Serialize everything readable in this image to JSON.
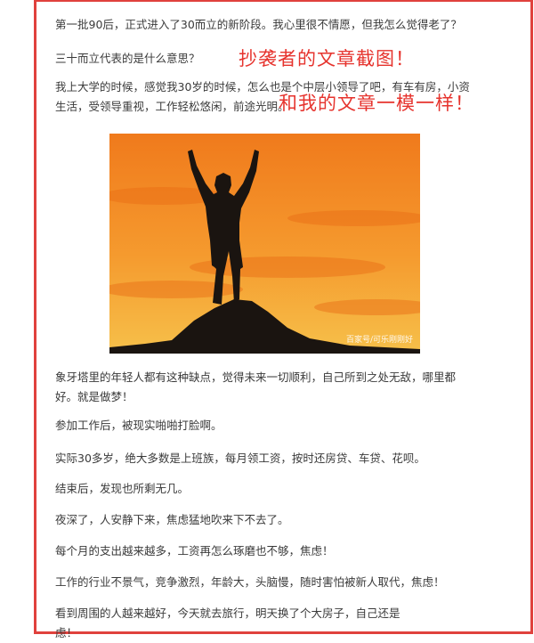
{
  "article": {
    "paragraphs": [
      "第一批90后，正式进入了30而立的新阶段。我心里很不情愿，但我怎么觉得老了？",
      "三十而立代表的是什么意思？",
      "我上大学的时候，感觉我30岁的时候，怎么也是个中层小领导了吧，有车有房，小资生活，受领导重视，工作轻松悠闲，前途光明。",
      "象牙塔里的年轻人都有这种缺点，觉得未来一切顺利，自己所到之处无敌，哪里都好。就是做梦！",
      "参加工作后，被现实啪啪打脸啊。",
      "实际30多岁，绝大多数是上班族，每月领工资，按时还房贷、车贷、花呗。",
      "结束后，发现也所剩无几。",
      "夜深了，人安静下来，焦虑猛地吹来下不去了。",
      "每个月的支出越来越多，工资再怎么琢磨也不够，焦虑！",
      "工作的行业不景气，竞争激烈，年龄大，头脑慢，随时害怕被新人取代，焦虑！",
      "看到周围的人越来越好，今天就去旅行，明天换了个大房子，自己还是虑！"
    ]
  },
  "annotations": {
    "line1": "抄袭者的文章截图！",
    "line2": "和我的文章一模一样！"
  },
  "image": {
    "watermark": "百家号/可乐刚刚好",
    "sky_top": "#f07a1c",
    "sky_bottom": "#f6c04a",
    "silhouette": "#1a1410"
  },
  "colors": {
    "frame": "#e0413d",
    "annotation": "#e6332d"
  }
}
